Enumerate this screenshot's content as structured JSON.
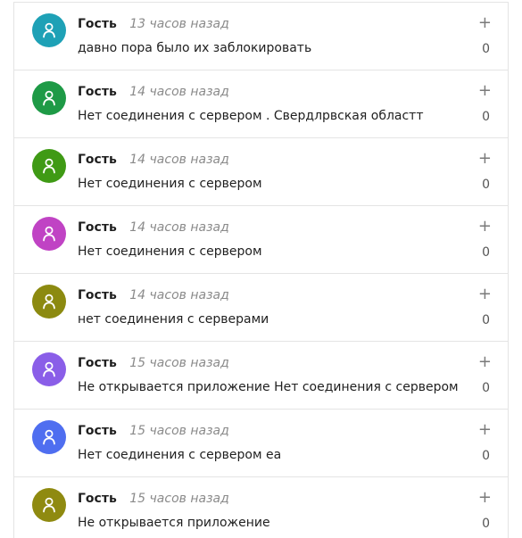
{
  "comments": [
    {
      "author": "Гость",
      "time": "13 часов назад",
      "text": "давно пора было их заблокировать",
      "plus": "+",
      "votes": "0",
      "avatar_color": "#1ea1b6",
      "avatar_icon": "user-icon"
    },
    {
      "author": "Гость",
      "time": "14 часов назад",
      "text": "Нет соединения с сервером . Свердлрвская областт",
      "plus": "+",
      "votes": "0",
      "avatar_color": "#1e9a46",
      "avatar_icon": "user-icon"
    },
    {
      "author": "Гость",
      "time": "14 часов назад",
      "text": "Нет соединения с сервером",
      "plus": "+",
      "votes": "0",
      "avatar_color": "#3f9a15",
      "avatar_icon": "user-icon"
    },
    {
      "author": "Гость",
      "time": "14 часов назад",
      "text": "Нет соединения с сервером",
      "plus": "+",
      "votes": "0",
      "avatar_color": "#c043c4",
      "avatar_icon": "user-icon"
    },
    {
      "author": "Гость",
      "time": "14 часов назад",
      "text": "нет соединения с серверами",
      "plus": "+",
      "votes": "0",
      "avatar_color": "#8c8a10",
      "avatar_icon": "user-icon"
    },
    {
      "author": "Гость",
      "time": "15 часов назад",
      "text": "Не открывается приложение Нет соединения с сервером",
      "plus": "+",
      "votes": "0",
      "avatar_color": "#8a5ee8",
      "avatar_icon": "user-icon"
    },
    {
      "author": "Гость",
      "time": "15 часов назад",
      "text": "Нет соединения с сервером ea",
      "plus": "+",
      "votes": "0",
      "avatar_color": "#4f6ef0",
      "avatar_icon": "user-icon"
    },
    {
      "author": "Гость",
      "time": "15 часов назад",
      "text": "Не открывается приложение",
      "plus": "+",
      "votes": "0",
      "avatar_color": "#8f8a10",
      "avatar_icon": "user-icon"
    }
  ]
}
